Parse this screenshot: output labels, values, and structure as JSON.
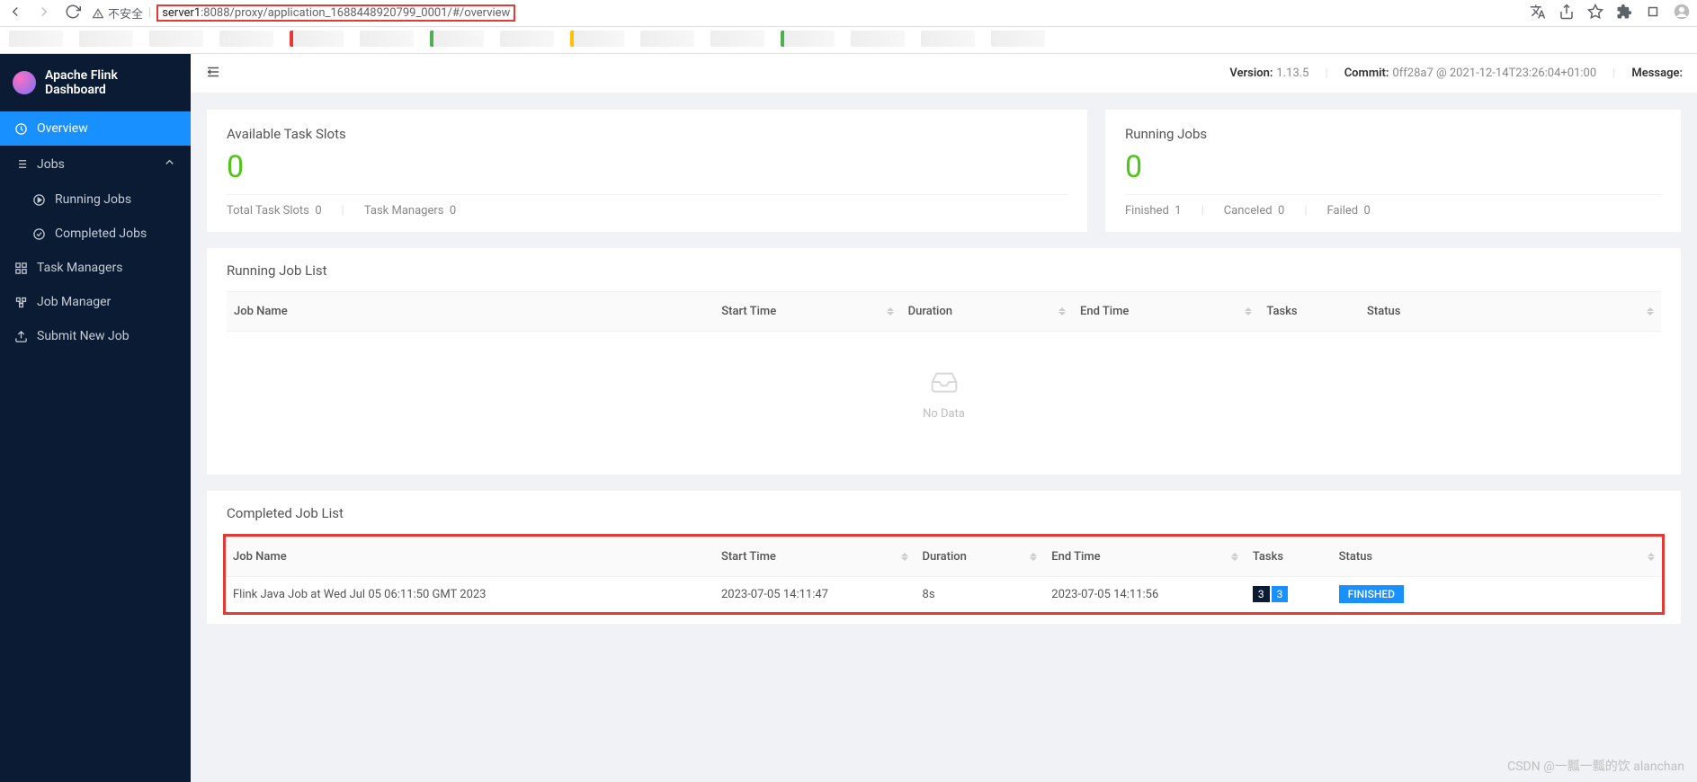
{
  "browser": {
    "warn_text": "不安全",
    "url_host": "server1",
    "url_rest": ":8088/proxy/application_1688448920799_0001/#/overview"
  },
  "app_title": "Apache Flink Dashboard",
  "sidebar": {
    "overview": "Overview",
    "jobs": "Jobs",
    "running_jobs": "Running Jobs",
    "completed_jobs": "Completed Jobs",
    "task_managers": "Task Managers",
    "job_manager": "Job Manager",
    "submit_new_job": "Submit New Job"
  },
  "topbar": {
    "version_label": "Version:",
    "version_val": "1.13.5",
    "commit_label": "Commit:",
    "commit_val": "0ff28a7 @ 2021-12-14T23:26:04+01:00",
    "message_label": "Message:"
  },
  "slots_card": {
    "title": "Available Task Slots",
    "value": "0",
    "total_label": "Total Task Slots",
    "total_val": "0",
    "tm_label": "Task Managers",
    "tm_val": "0"
  },
  "running_card": {
    "title": "Running Jobs",
    "value": "0",
    "finished_label": "Finished",
    "finished_val": "1",
    "canceled_label": "Canceled",
    "canceled_val": "0",
    "failed_label": "Failed",
    "failed_val": "0"
  },
  "running_section": {
    "title": "Running Job List",
    "cols": {
      "job_name": "Job Name",
      "start": "Start Time",
      "duration": "Duration",
      "end": "End Time",
      "tasks": "Tasks",
      "status": "Status"
    },
    "empty": "No Data"
  },
  "completed_section": {
    "title": "Completed Job List",
    "cols": {
      "job_name": "Job Name",
      "start": "Start Time",
      "duration": "Duration",
      "end": "End Time",
      "tasks": "Tasks",
      "status": "Status"
    },
    "row": {
      "name": "Flink Java Job at Wed Jul 05 06:11:50 GMT 2023",
      "start": "2023-07-05 14:11:47",
      "duration": "8s",
      "end": "2023-07-05 14:11:56",
      "task_a": "3",
      "task_b": "3",
      "status": "FINISHED"
    }
  },
  "watermark": "CSDN @一瓢一瓢的饮 alanchan"
}
